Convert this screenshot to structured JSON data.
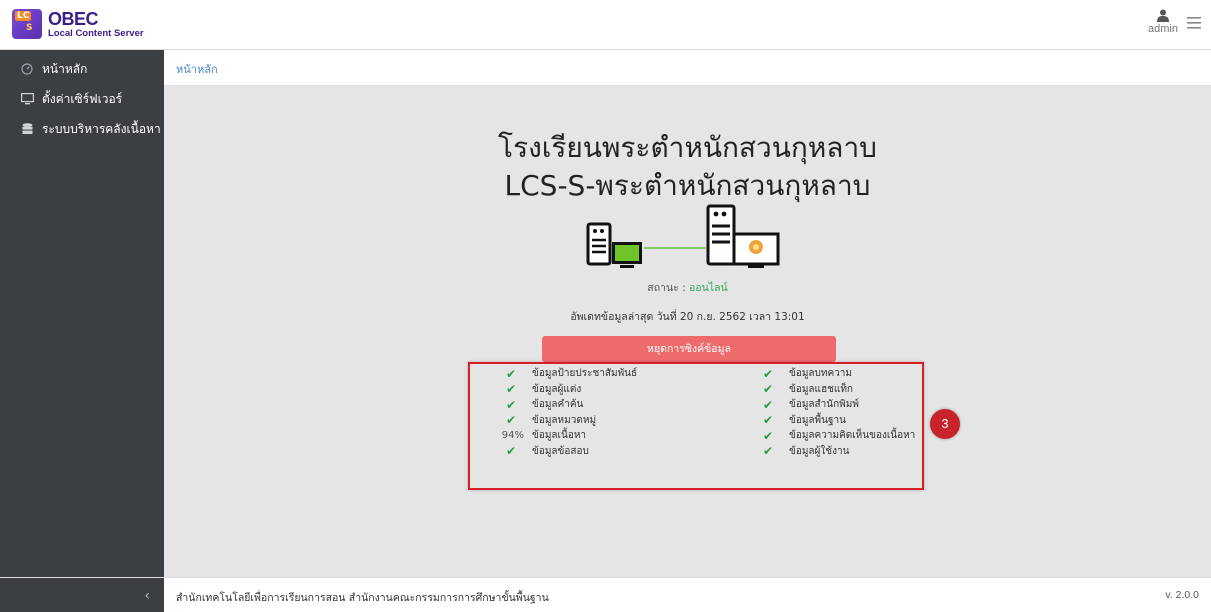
{
  "app": {
    "logo_badge_a": "LC",
    "logo_badge_b": "S",
    "name": "OBEC",
    "subtitle": "Local Content Server"
  },
  "user": {
    "name": "admin",
    "icon": "user-icon"
  },
  "sidebar": {
    "items": [
      {
        "label": "หน้าหลัก",
        "icon": "dashboard-icon"
      },
      {
        "label": "ตั้งค่าเซิร์ฟเวอร์",
        "icon": "monitor-icon"
      },
      {
        "label": "ระบบบริหารคลังเนื้อหา",
        "icon": "database-icon"
      }
    ]
  },
  "breadcrumb": "หน้าหลัก",
  "main": {
    "school_name": "โรงเรียนพระตำหนักสวนกุหลาบ",
    "server_name": "LCS-S-พระตำหนักสวนกุหลาบ",
    "status_label": "สถานะ :",
    "status_value": "ออนไลน์",
    "last_updated": "อัพเดทข้อมูลล่าสุด วันที่ 20 ก.ย. 2562 เวลา 13:01",
    "stop_sync_label": "หยุดการซิงค์ข้อมูล",
    "sync_items_left": [
      {
        "label": "ข้อมูลป้ายประชาสัมพันธ์",
        "mark": "✔"
      },
      {
        "label": "ข้อมูลผู้แต่ง",
        "mark": "✔"
      },
      {
        "label": "ข้อมูลคำค้น",
        "mark": "✔"
      },
      {
        "label": "ข้อมูลหมวดหมู่",
        "mark": "✔"
      },
      {
        "label": "ข้อมูลเนื้อหา",
        "mark": "94%"
      },
      {
        "label": "ข้อมูลข้อสอบ",
        "mark": "✔"
      }
    ],
    "sync_items_right": [
      {
        "label": "ข้อมูลบทความ",
        "mark": "✔"
      },
      {
        "label": "ข้อมูลแฮชแท็ก",
        "mark": "✔"
      },
      {
        "label": "ข้อมูลสำนักพิมพ์",
        "mark": "✔"
      },
      {
        "label": "ข้อมูลพื้นฐาน",
        "mark": "✔"
      },
      {
        "label": "ข้อมูลความคิดเห็นของเนื้อหา",
        "mark": "✔"
      },
      {
        "label": "ข้อมูลผู้ใช้งาน",
        "mark": "✔"
      }
    ],
    "step_badge": "3"
  },
  "footer": {
    "toggle": "‹",
    "text": "สำนักเทคโนโลยีเพื่อการเรียนการสอน สำนักงานคณะกรรมการการศึกษาขั้นพื้นฐาน",
    "version": "v. 2.0.0"
  },
  "colors": {
    "sidebar_bg": "#3b3f43",
    "main_bg": "#e5e5e5",
    "stop_button": "#ee6b6b",
    "check": "#2e9b46",
    "status_online": "#2eaa5c",
    "highlight": "#d81f2b"
  }
}
